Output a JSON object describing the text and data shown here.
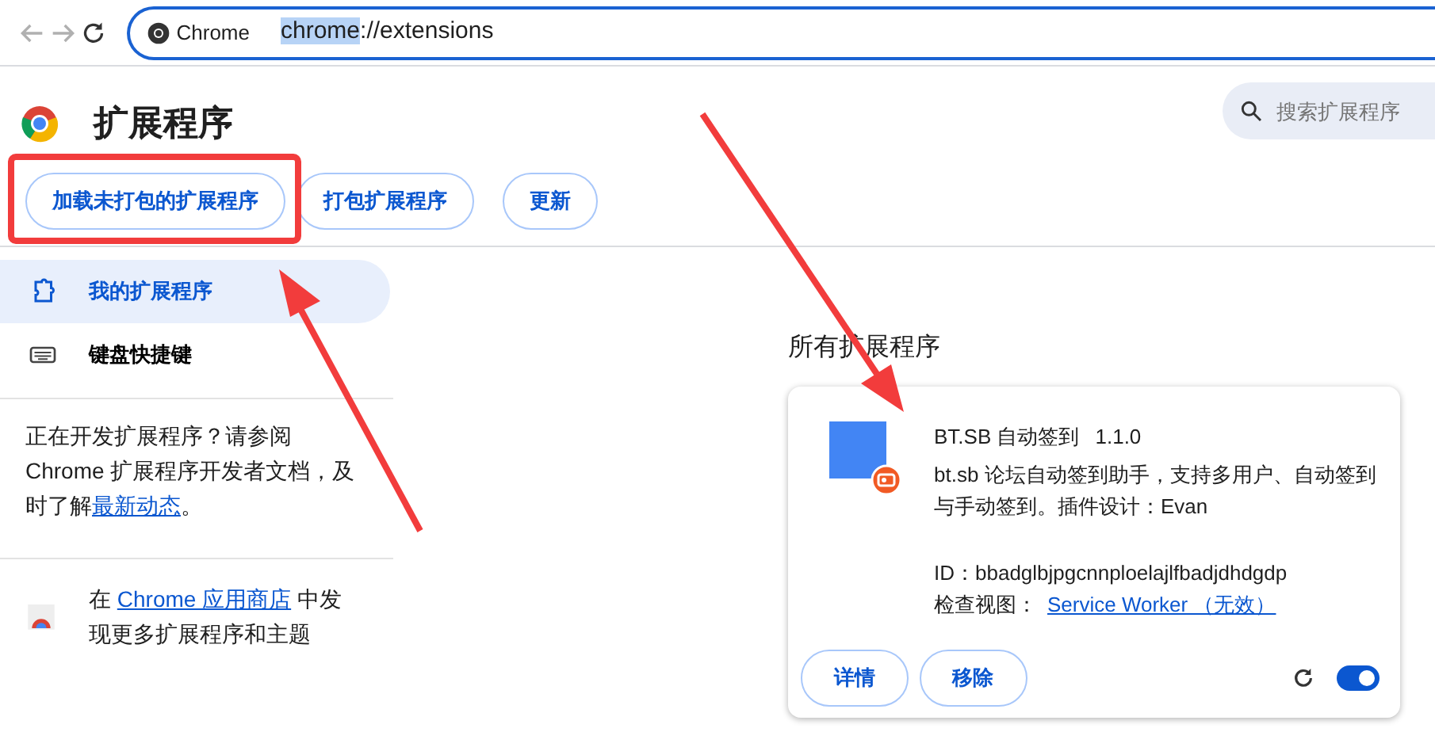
{
  "browser": {
    "address_chip": "Chrome",
    "url_selected": "chrome",
    "url_rest": "://extensions"
  },
  "header": {
    "title": "扩展程序",
    "search": {
      "placeholder": "搜索扩展程序"
    }
  },
  "toolbar_buttons": [
    "加载未打包的扩展程序",
    "打包扩展程序",
    "更新"
  ],
  "sidebar": {
    "items": [
      {
        "label": "我的扩展程序",
        "kind": "puzzle",
        "selected": true
      },
      {
        "label": "键盘快捷键",
        "kind": "keyboard",
        "selected": false
      }
    ],
    "dev_note": {
      "text": "正在开发扩展程序？请参阅 Chrome 扩展程序开发者文档，及时了解",
      "link": "最新动态",
      "end": "。"
    },
    "store_note": {
      "before": "在 ",
      "link": "Chrome 应用商店",
      "after": " 中发现更多扩展程序和主题"
    }
  },
  "section_title": "所有扩展程序",
  "extensions": [
    {
      "name": "BT.SB 自动签到",
      "version": "1.1.0",
      "description": "bt.sb 论坛自动签到助手，支持多用户、自动签到与手动签到。插件设计：Evan",
      "id": "ID：bbadglbjpgcnnploelajlfbadjdhdgdp",
      "inspect_label": "检查视图：",
      "inspect_link": "Service Worker （无效）",
      "buttons": [
        "详情",
        "移除"
      ],
      "enabled": true
    }
  ]
}
